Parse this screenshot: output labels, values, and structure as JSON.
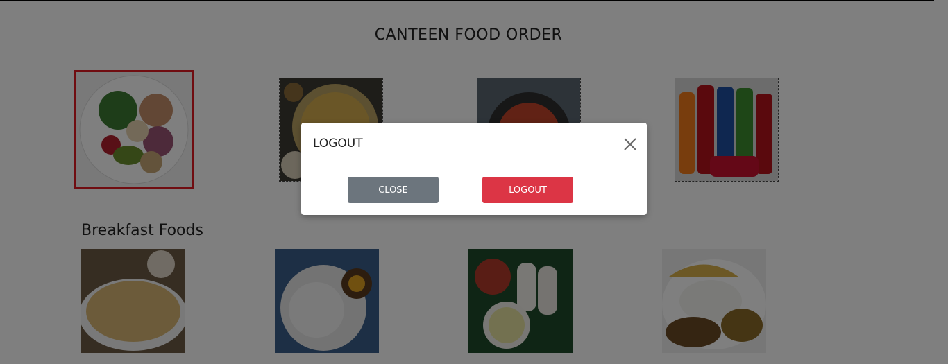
{
  "page": {
    "title": "CANTEEN FOOD ORDER"
  },
  "categories": [
    {
      "name": "salad-bowl-image",
      "selected": true
    },
    {
      "name": "fried-rice-image",
      "selected": false
    },
    {
      "name": "pasta-image",
      "selected": false
    },
    {
      "name": "soft-drinks-image",
      "selected": false
    }
  ],
  "breakfast": {
    "title": "Breakfast Foods",
    "items": [
      "paratha-image",
      "string-hoppers-image",
      "pittu-image",
      "rice-curry-image"
    ]
  },
  "modal": {
    "title": "LOGOUT",
    "close_label": "CLOSE",
    "logout_label": "LOGOUT"
  },
  "colors": {
    "selected_border": "#e01b22",
    "close_button": "#6c757d",
    "logout_button": "#dc3545",
    "overlay": "rgba(0,0,0,0.5)"
  }
}
